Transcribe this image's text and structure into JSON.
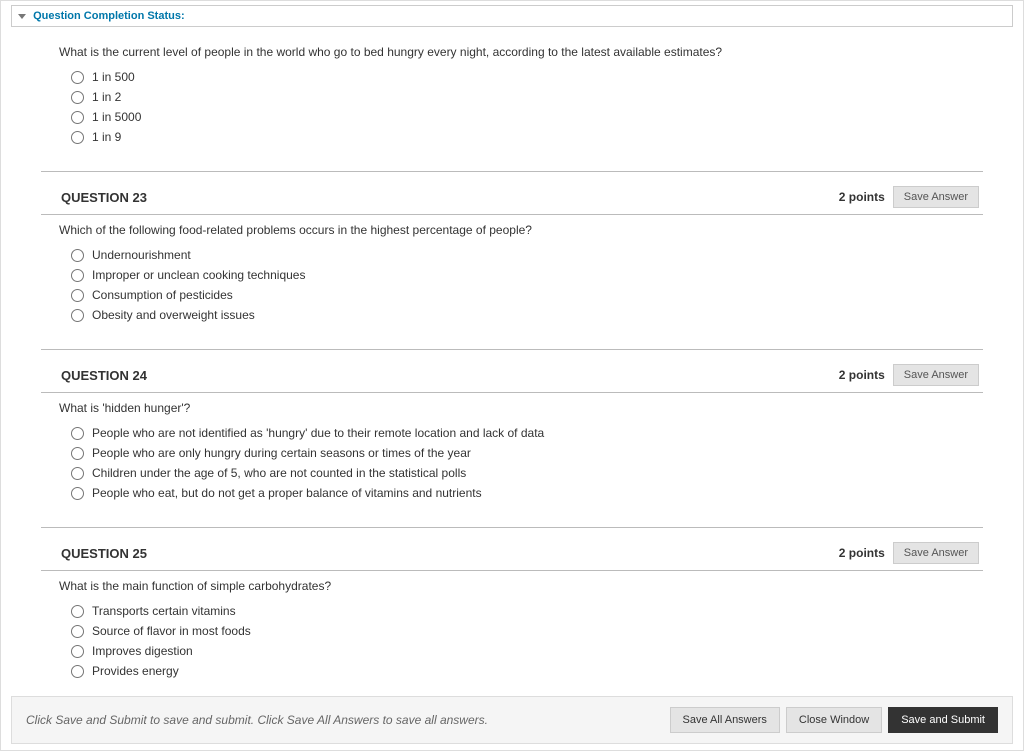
{
  "status_bar": {
    "label": "Question Completion Status:"
  },
  "questions": {
    "q22": {
      "prompt": "What is the current level of people in the world who go to bed hungry every night, according to the latest available estimates?",
      "options": [
        "1 in 500",
        "1 in 2",
        "1 in 5000",
        "1 in 9"
      ]
    },
    "q23": {
      "title": "QUESTION 23",
      "points": "2 points",
      "save_label": "Save Answer",
      "prompt": "Which of the following food-related problems occurs in the highest percentage of people?",
      "options": [
        "Undernourishment",
        "Improper or unclean cooking techniques",
        "Consumption of pesticides",
        "Obesity and overweight issues"
      ]
    },
    "q24": {
      "title": "QUESTION 24",
      "points": "2 points",
      "save_label": "Save Answer",
      "prompt": "What is 'hidden hunger'?",
      "options": [
        "People who are not identified as 'hungry' due to their remote location and lack of data",
        "People who are only hungry during certain seasons or times of the year",
        "Children under the age of 5, who are not counted in the statistical polls",
        "People who eat, but do not get a proper balance of vitamins and nutrients"
      ]
    },
    "q25": {
      "title": "QUESTION 25",
      "points": "2 points",
      "save_label": "Save Answer",
      "prompt": "What is the main function of simple carbohydrates?",
      "options": [
        "Transports certain vitamins",
        "Source of flavor in most foods",
        "Improves digestion",
        "Provides energy"
      ]
    }
  },
  "footer": {
    "hint": "Click Save and Submit to save and submit. Click Save All Answers to save all answers.",
    "save_all": "Save All Answers",
    "close": "Close Window",
    "submit": "Save and Submit"
  }
}
